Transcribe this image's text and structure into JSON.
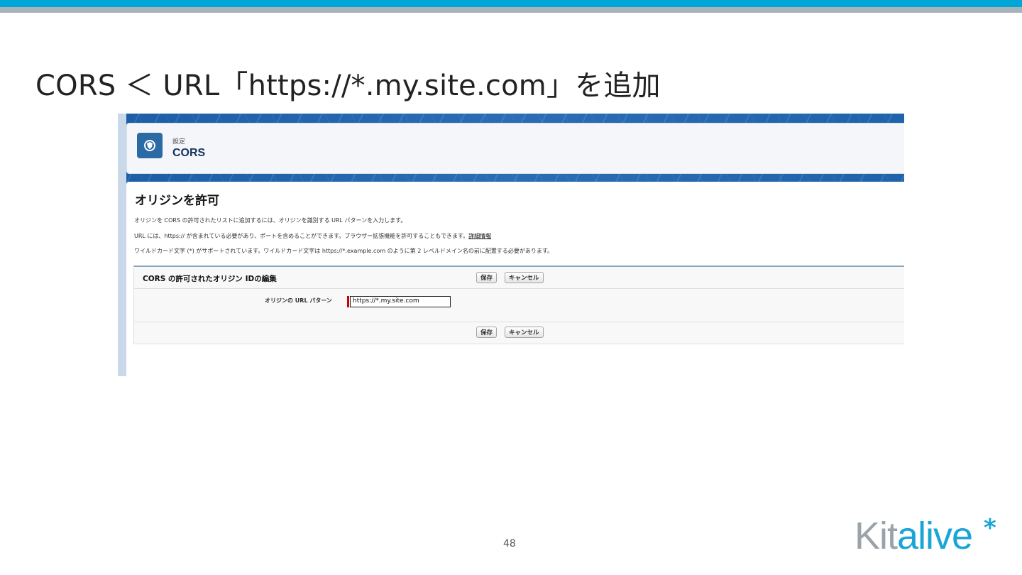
{
  "slide": {
    "title": "CORS ＜ URL「https://*.my.site.com」を追加",
    "page_number": "48",
    "logo": {
      "text_part1": "Kit",
      "text_part2": "alive",
      "star": "*",
      "colors": {
        "part1": "#9aa3aa",
        "part2": "#1aa5d6"
      }
    }
  },
  "header": {
    "icon": "shield-icon",
    "breadcrumb": "設定",
    "title": "CORS"
  },
  "main": {
    "section_title": "オリジンを許可",
    "descriptions": [
      "オリジンを CORS の許可されたリストに追加するには、オリジンを識別する URL パターンを入力します。",
      "URL には、https:// が含まれている必要があり、ポートを含めることができます。ブラウザー拡張機能を許可することもできます。",
      "ワイルドカード文字 (*) がサポートされています。ワイルドカード文字は https://*.example.com のように第 2 レベルドメイン名の前に配置する必要があります。"
    ],
    "help_link": "詳細情報",
    "edit": {
      "title": "CORS の許可されたオリジン IDの編集",
      "save_label": "保存",
      "cancel_label": "キャンセル",
      "field_label": "オリジンの URL パターン",
      "field_value": "https://*.my.site.com"
    }
  },
  "colors": {
    "accent": "#00a6d6",
    "header_band": "#1f63ab",
    "required": "#cc0000"
  }
}
